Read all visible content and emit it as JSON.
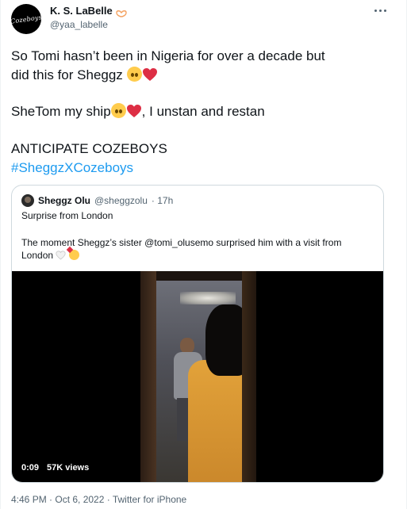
{
  "author": {
    "display_name": "K. S. LaBelle",
    "handle": "@yaa_labelle",
    "avatar_text": "Cozeboys"
  },
  "tweet": {
    "line1": "So Tomi hasn’t been in Nigeria for over a decade but",
    "line2": "did this for Sheggz",
    "line3_start": "SheTom my ship",
    "line3_end": ", I unstan and restan",
    "line4": "ANTICIPATE COZEBOYS",
    "hashtag": "#SheggzXCozeboys"
  },
  "quoted": {
    "display_name": "Sheggz Olu",
    "handle": "@sheggzolu",
    "time": "· 17h",
    "text1": "Surprise from London",
    "text2": "The moment Sheggz’s sister @tomi_olusemo surprised him with a visit from",
    "text3": "London",
    "video": {
      "duration": "0:09",
      "views": "57K views"
    }
  },
  "footer": {
    "timestamp": "4:46 PM · Oct 6, 2022 · Twitter for iPhone"
  },
  "icons": {
    "more": "more-horizontal-icon",
    "author_badge": "heart-hands-icon",
    "face": "pleading-face-emoji",
    "heart": "red-heart-emoji"
  },
  "colors": {
    "link": "#1d9bf0",
    "secondary_text": "#536471",
    "border": "#cfd9de",
    "heart": "#dd2e44"
  }
}
